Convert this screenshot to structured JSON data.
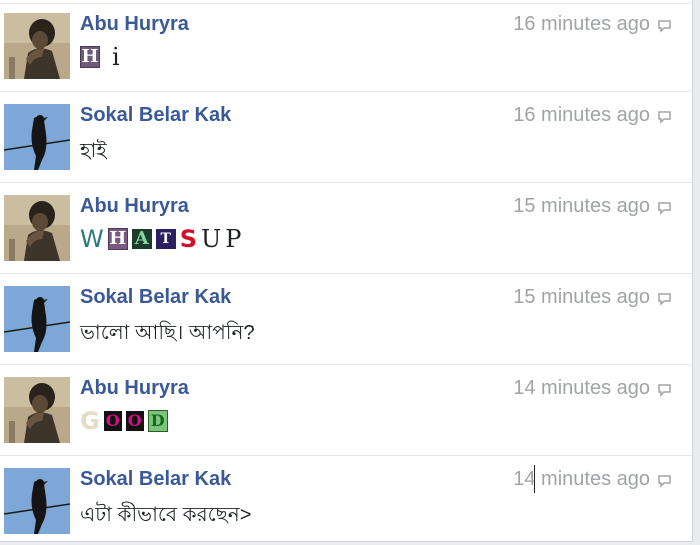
{
  "colors": {
    "name": "#3b5998",
    "timestamp": "#a0a3a8",
    "text": "#1d2129",
    "divider": "#e5e7ea"
  },
  "messages": [
    {
      "sender": "Abu Huryra",
      "avatar": "man-hand-on-chin-avatar",
      "time": "16 minutes ago",
      "text": "H i"
    },
    {
      "sender": "Sokal Belar Kak",
      "avatar": "crow-on-wire-avatar",
      "time": "16 minutes ago",
      "text": "হাই"
    },
    {
      "sender": "Abu Huryra",
      "avatar": "man-hand-on-chin-avatar",
      "time": "15 minutes ago",
      "text": "WHATSUP"
    },
    {
      "sender": "Sokal Belar Kak",
      "avatar": "crow-on-wire-avatar",
      "time": "15 minutes ago",
      "text": "ভালো আছি। আপনি?"
    },
    {
      "sender": "Abu Huryra",
      "avatar": "man-hand-on-chin-avatar",
      "time": "14 minutes ago",
      "text": "GOOD"
    },
    {
      "sender": "Sokal Belar Kak",
      "avatar": "crow-on-wire-avatar",
      "time": "14 minutes ago",
      "text": "এটা কীভাবে করছেন>"
    }
  ]
}
